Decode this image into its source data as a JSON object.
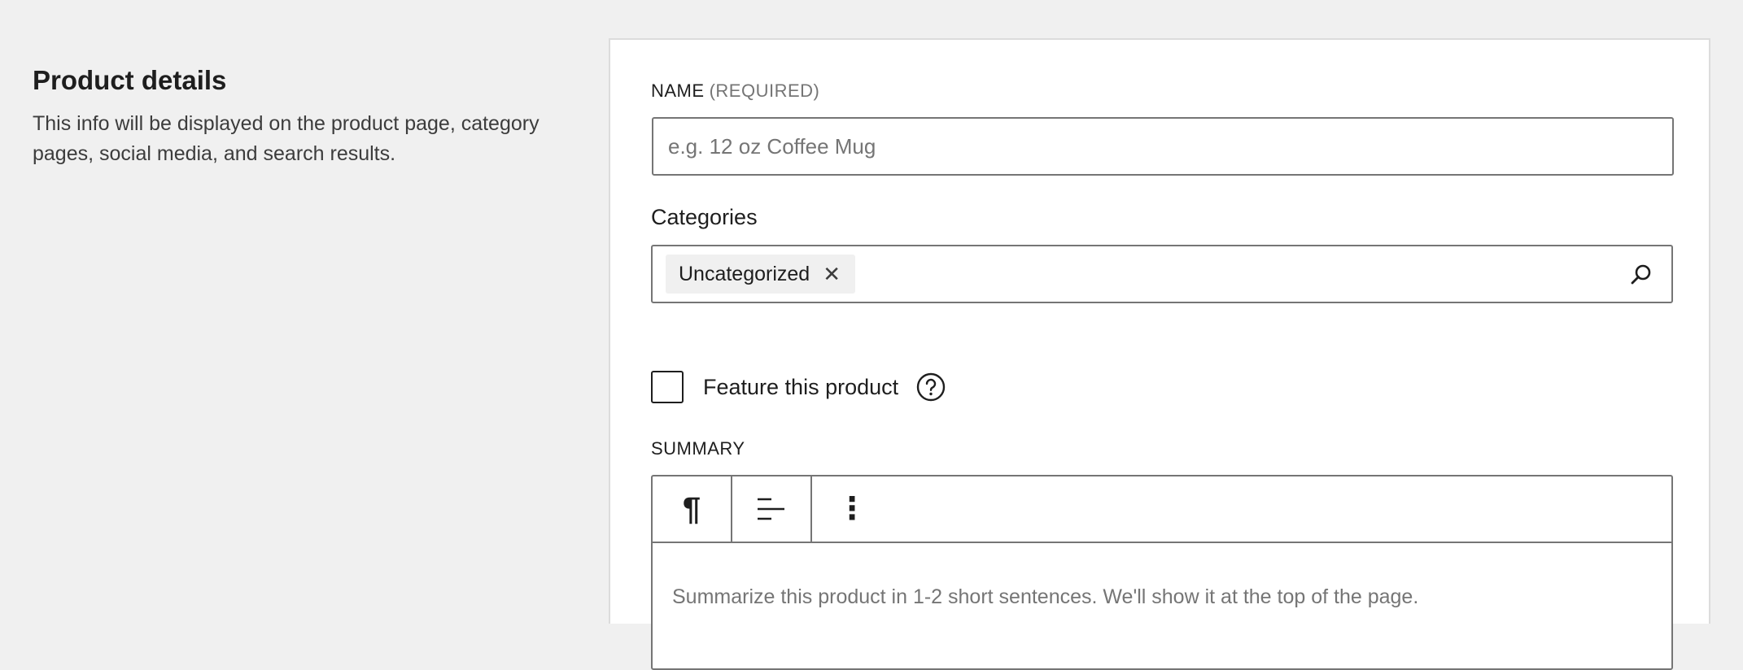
{
  "intro": {
    "title": "Product details",
    "description": "This info will be displayed on the product page, category pages, social media, and search results."
  },
  "form": {
    "name": {
      "label": "NAME",
      "required_text": "(REQUIRED)",
      "placeholder": "e.g. 12 oz Coffee Mug",
      "value": ""
    },
    "categories": {
      "label": "Categories",
      "selected": [
        "Uncategorized"
      ],
      "remove_symbol": "✕",
      "search_icon": "search-icon"
    },
    "feature": {
      "label": "Feature this product",
      "checked": false,
      "help_icon": "help-icon"
    },
    "summary": {
      "label": "SUMMARY",
      "toolbar": [
        {
          "name": "paragraph-icon",
          "glyph": "¶"
        },
        {
          "name": "align-left-icon"
        },
        {
          "name": "more-options-icon",
          "glyph": "⋮"
        }
      ],
      "placeholder": "Summarize this product in 1-2 short sentences. We'll show it at the top of the page."
    }
  },
  "colors": {
    "background": "#f0f0f0",
    "card": "#ffffff",
    "border": "#757575",
    "text": "#1e1e1e",
    "muted": "#757575"
  }
}
